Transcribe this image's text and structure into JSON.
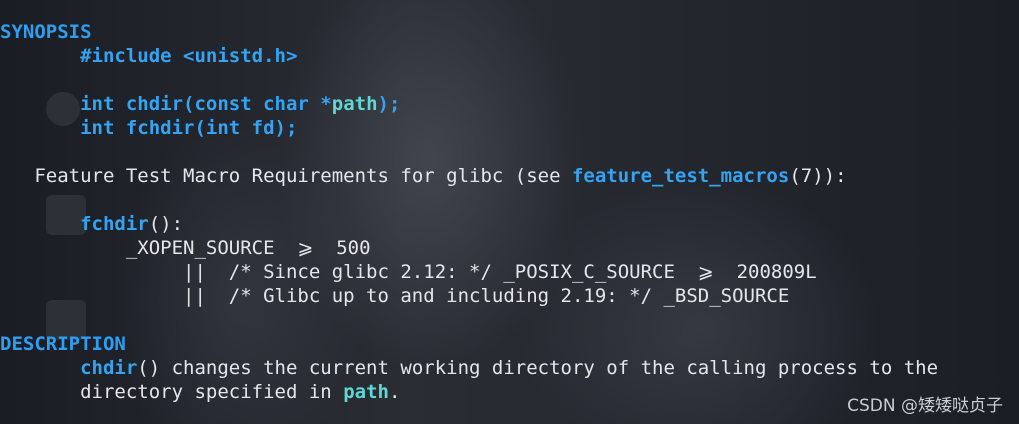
{
  "colors": {
    "heading": "#2d9ef0",
    "keyword": "#33a3f2",
    "parameter": "#5fd7d2",
    "text": "#e4e6ea",
    "background": "#1c1f26"
  },
  "synopsis": {
    "heading": "SYNOPSIS",
    "include": "#include <unistd.h>",
    "decl1": {
      "keywords": "int chdir(const char *",
      "param": "path",
      "end": ");"
    },
    "decl2": "int fchdir(int fd);"
  },
  "feature_test": {
    "prefix": "Feature Test Macro Requirements for glibc (see ",
    "link": "feature_test_macros",
    "suffix": "(7)):",
    "func_name": "fchdir",
    "func_suffix": "():",
    "line1": "_XOPEN_SOURCE  ⩾  500",
    "line2": "||  /* Since glibc 2.12: */ _POSIX_C_SOURCE  ⩾  200809L",
    "line3": "||  /* Glibc up to and including 2.19: */ _BSD_SOURCE"
  },
  "description": {
    "heading": "DESCRIPTION",
    "func_name": "chdir",
    "line1_rest": "() changes the current working directory of the calling process to the",
    "line2_prefix": "directory specified in ",
    "param": "path",
    "line2_suffix": "."
  },
  "watermark": "CSDN @矮矮哒贞子"
}
